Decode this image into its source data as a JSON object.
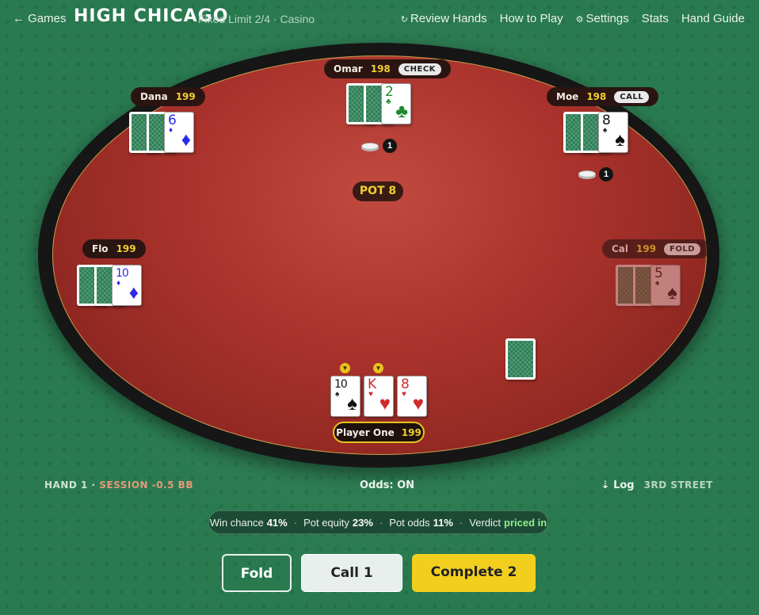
{
  "header": {
    "back_label": "← Games",
    "title": "HIGH CHICAGO",
    "subtitle": "Fixed Limit 2/4 · Casino",
    "nav": {
      "review_icon": "↻",
      "review": "Review Hands",
      "how_to_play": "How to Play",
      "settings_icon": "⚙",
      "settings": "Settings",
      "stats": "Stats",
      "hand_guide": "Hand Guide"
    }
  },
  "players": {
    "omar": {
      "name": "Omar",
      "stack": "198",
      "action": "CHECK",
      "up_rank": "2",
      "up_suit": "♣",
      "bet": "1"
    },
    "dana": {
      "name": "Dana",
      "stack": "199",
      "up_rank": "6",
      "up_suit": "♦"
    },
    "moe": {
      "name": "Moe",
      "stack": "198",
      "action": "CALL",
      "up_rank": "8",
      "up_suit": "♠",
      "bet": "1"
    },
    "flo": {
      "name": "Flo",
      "stack": "199",
      "up_rank": "10",
      "up_suit": "♦"
    },
    "cal": {
      "name": "Cal",
      "stack": "199",
      "action": "FOLD",
      "up_rank": "5",
      "up_suit": "♠"
    }
  },
  "hero": {
    "name": "Player One",
    "stack": "199",
    "cards": [
      {
        "rank": "10",
        "suit": "♠"
      },
      {
        "rank": "K",
        "suit": "♥"
      },
      {
        "rank": "8",
        "suit": "♥"
      }
    ],
    "marker_icon": "▼"
  },
  "pot": {
    "label": "POT 8"
  },
  "status": {
    "hand": "HAND 1 ·",
    "session": "SESSION -0.5 BB",
    "odds": "Odds: ON",
    "log": "⇣ Log",
    "street": "3RD STREET"
  },
  "odds_bar": {
    "win_label": "Win chance",
    "win_value": "41%",
    "equity_label": "Pot equity",
    "equity_value": "23%",
    "pot_odds_label": "Pot odds",
    "pot_odds_value": "11%",
    "verdict_label": "Verdict",
    "verdict_value": "priced in",
    "separator": "·"
  },
  "actions": {
    "fold": "Fold",
    "call": "Call 1",
    "complete": "Complete 2"
  },
  "colors": {
    "felt_green": "#2a7a50",
    "table_red": "#a8322b",
    "accent_yellow": "#f2cf1f",
    "stack_yellow": "#f1cf2f",
    "verdict_green": "#8ef08a"
  }
}
